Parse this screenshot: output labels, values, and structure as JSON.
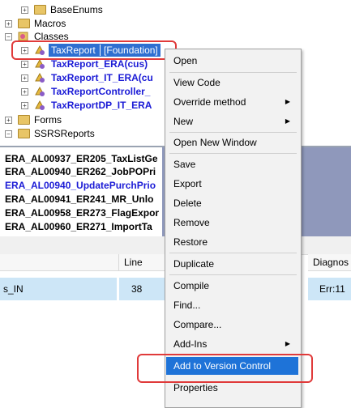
{
  "tree": {
    "items": [
      {
        "label": "BaseEnums",
        "indent": 2,
        "icon": "folder-icon"
      },
      {
        "label": "Macros",
        "indent": 1,
        "icon": "folder-icon"
      },
      {
        "label": "Classes",
        "indent": 1,
        "icon": "classes-icon"
      },
      {
        "label": "TaxReport",
        "label2": "[Foundation]",
        "indent": 2,
        "icon": "class-icon",
        "selected": true
      },
      {
        "label": "TaxReport_ERA(cus)",
        "indent": 2,
        "icon": "class-icon"
      },
      {
        "label": "TaxReport_IT_ERA(cu",
        "indent": 2,
        "icon": "class-icon"
      },
      {
        "label": "TaxReportController_",
        "indent": 2,
        "icon": "class-icon"
      },
      {
        "label": "TaxReportDP_IT_ERA",
        "indent": 2,
        "icon": "class-icon"
      },
      {
        "label": "Forms",
        "indent": 1,
        "icon": "folder-icon"
      },
      {
        "label": "SSRSReports",
        "indent": 1,
        "icon": "folder-icon"
      }
    ]
  },
  "list": {
    "items": [
      "ERA_AL00937_ER205_TaxListGe",
      "ERA_AL00940_ER262_JobPOPri",
      "ERA_AL00940_UpdatePurchPrio",
      "ERA_AL00941_ER241_MR_Unlo",
      "ERA_AL00958_ER273_FlagExpor",
      "ERA_AL00960_ER271_ImportTa"
    ],
    "highlight_index": 2
  },
  "grid": {
    "columns": [
      "Line",
      "Diagnos"
    ],
    "row": {
      "name": "s_IN",
      "line": "38",
      "diag": "Err:11"
    }
  },
  "menu": {
    "items": [
      {
        "label": "Open",
        "submenu": false
      },
      {
        "sep": true
      },
      {
        "label": "View Code",
        "submenu": false
      },
      {
        "label": "Override method",
        "submenu": true
      },
      {
        "label": "New",
        "submenu": true
      },
      {
        "sep": true
      },
      {
        "label": "Open New Window",
        "submenu": false
      },
      {
        "sep": true
      },
      {
        "label": "Save",
        "submenu": false
      },
      {
        "label": "Export",
        "submenu": false
      },
      {
        "label": "Delete",
        "submenu": false
      },
      {
        "label": "Remove",
        "submenu": false
      },
      {
        "label": "Restore",
        "submenu": false
      },
      {
        "sep": true
      },
      {
        "label": "Duplicate",
        "submenu": false
      },
      {
        "sep": true
      },
      {
        "label": "Compile",
        "submenu": false
      },
      {
        "label": "Find...",
        "submenu": false
      },
      {
        "label": "Compare...",
        "submenu": false
      },
      {
        "label": "Add-Ins",
        "submenu": true
      },
      {
        "label": "Add to Version Control",
        "submenu": false,
        "active": true
      },
      {
        "label": "Properties",
        "submenu": false
      }
    ]
  },
  "colors": {
    "selection": "#2e6fd1",
    "highlight_red": "#e03a3a",
    "list_link": "#1b1bd6",
    "menu_active": "#1e73d8"
  }
}
